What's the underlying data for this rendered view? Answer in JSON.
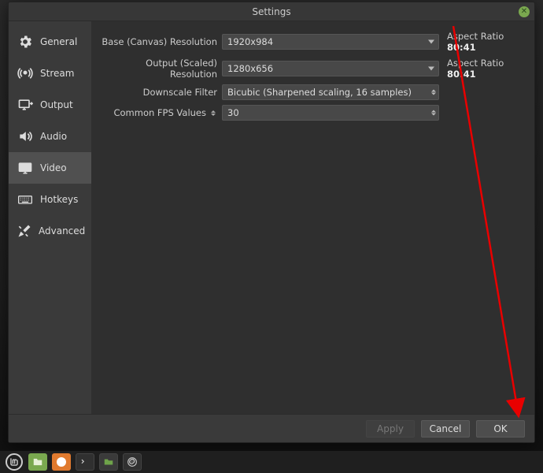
{
  "window": {
    "title": "Settings"
  },
  "sidebar": {
    "items": [
      {
        "label": "General"
      },
      {
        "label": "Stream"
      },
      {
        "label": "Output"
      },
      {
        "label": "Audio"
      },
      {
        "label": "Video"
      },
      {
        "label": "Hotkeys"
      },
      {
        "label": "Advanced"
      }
    ]
  },
  "video": {
    "base_label": "Base (Canvas) Resolution",
    "base_value": "1920x984",
    "base_aspect_label": "Aspect Ratio",
    "base_aspect_value": "80:41",
    "output_label": "Output (Scaled) Resolution",
    "output_value": "1280x656",
    "output_aspect_label": "Aspect Ratio",
    "output_aspect_value": "80:41",
    "filter_label": "Downscale Filter",
    "filter_value": "Bicubic (Sharpened scaling, 16 samples)",
    "fps_label": "Common FPS Values",
    "fps_value": "30"
  },
  "footer": {
    "apply": "Apply",
    "cancel": "Cancel",
    "ok": "OK"
  }
}
